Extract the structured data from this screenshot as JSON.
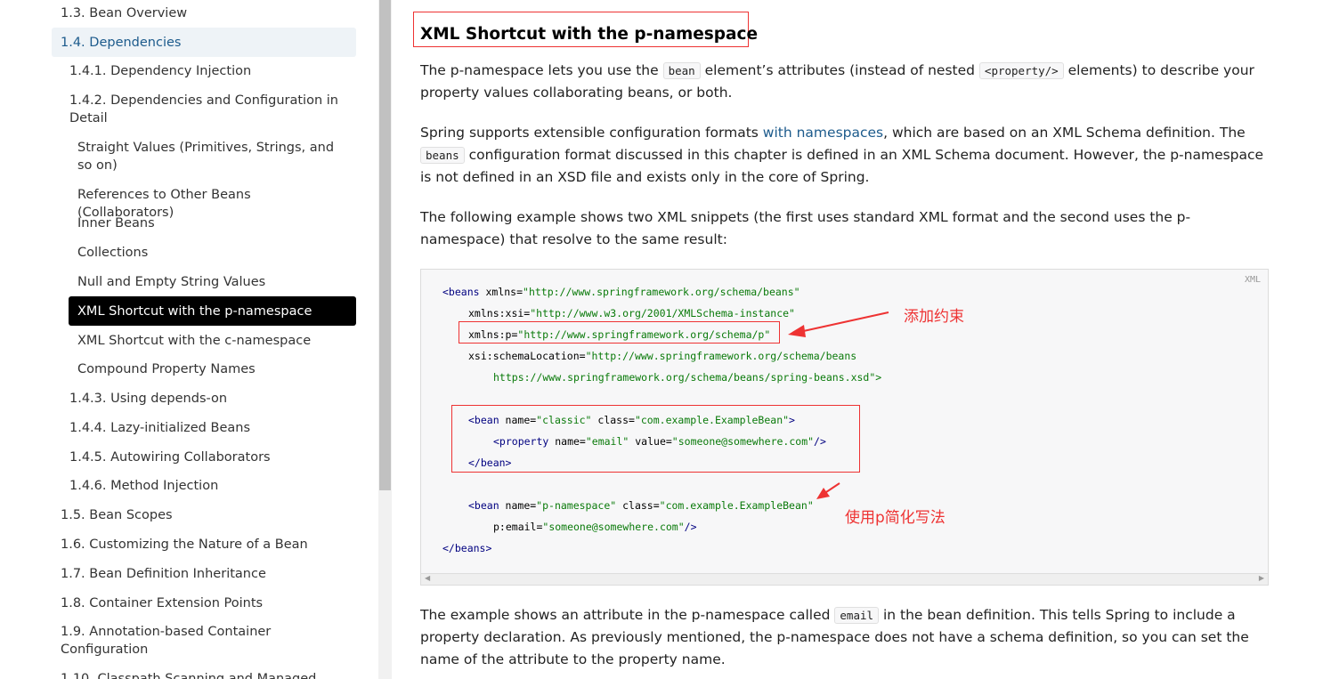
{
  "sidebar": {
    "items": [
      {
        "label": "1.3. Bean Overview"
      },
      {
        "label": "1.4. Dependencies"
      },
      {
        "label": "1.4.1. Dependency Injection"
      },
      {
        "label": "1.4.2. Dependencies and Configuration in Detail"
      },
      {
        "label": "Straight Values (Primitives, Strings, and so on)"
      },
      {
        "label": "References to Other Beans (Collaborators)"
      },
      {
        "label": "Inner Beans"
      },
      {
        "label": "Collections"
      },
      {
        "label": "Null and Empty String Values"
      },
      {
        "label": "XML Shortcut with the p-namespace"
      },
      {
        "label": "XML Shortcut with the c-namespace"
      },
      {
        "label": "Compound Property Names"
      },
      {
        "label": "1.4.3. Using depends-on"
      },
      {
        "label": "1.4.4. Lazy-initialized Beans"
      },
      {
        "label": "1.4.5. Autowiring Collaborators"
      },
      {
        "label": "1.4.6. Method Injection"
      },
      {
        "label": "1.5. Bean Scopes"
      },
      {
        "label": "1.6. Customizing the Nature of a Bean"
      },
      {
        "label": "1.7. Bean Definition Inheritance"
      },
      {
        "label": "1.8. Container Extension Points"
      },
      {
        "label": "1.9. Annotation-based Container Configuration"
      },
      {
        "label": "1.10. Classpath Scanning and Managed"
      }
    ]
  },
  "main": {
    "title": "XML Shortcut with the p-namespace",
    "p1": {
      "t1": "The p-namespace lets you use the ",
      "c1": "bean",
      "t2": " element’s attributes (instead of nested ",
      "c2": "<property/>",
      "t3": " elements) to describe your property values collaborating beans, or both."
    },
    "p2": {
      "t1": "Spring supports extensible configuration formats ",
      "link": "with namespaces",
      "t2": ", which are based on an XML Schema definition. The ",
      "c1": "beans",
      "t3": " configuration format discussed in this chapter is defined in an XML Schema document. However, the p-namespace is not defined in an XSD file and exists only in the core of Spring."
    },
    "p3": "The following example shows two XML snippets (the first uses standard XML format and the second uses the p-namespace) that resolve to the same result:",
    "code": {
      "lang": "XML",
      "lines": {
        "l1a": "<beans",
        "l1b": " xmlns=",
        "l1c": "\"http://www.springframework.org/schema/beans\"",
        "l2a": "xmlns:xsi=",
        "l2b": "\"http://www.w3.org/2001/XMLSchema-instance\"",
        "l3a": "xmlns:p=",
        "l3b": "\"http://www.springframework.org/schema/p\"",
        "l4a": "xsi:schemaLocation=",
        "l4b": "\"http://www.springframework.org/schema/beans",
        "l5": "https://www.springframework.org/schema/beans/spring-beans.xsd\">",
        "l6a": "<bean",
        "l6b": " name=",
        "l6c": "\"classic\"",
        "l6d": " class=",
        "l6e": "\"com.example.ExampleBean\"",
        "l6f": ">",
        "l7a": "<property",
        "l7b": " name=",
        "l7c": "\"email\"",
        "l7d": " value=",
        "l7e": "\"someone@somewhere.com\"",
        "l7f": "/>",
        "l8": "</bean>",
        "l9a": "<bean",
        "l9b": " name=",
        "l9c": "\"p-namespace\"",
        "l9d": " class=",
        "l9e": "\"com.example.ExampleBean\"",
        "l10a": "p:email=",
        "l10b": "\"someone@somewhere.com\"",
        "l10c": "/>",
        "l11": "</beans>"
      }
    },
    "annotations": {
      "a1": "添加约束",
      "a2": "使用p简化写法"
    },
    "p4": {
      "t1": "The example shows an attribute in the p-namespace called ",
      "c1": "email",
      "t2": " in the bean definition. This tells Spring to include a property declaration. As previously mentioned, the p-namespace does not have a schema definition, so you can set the name of the attribute to the property name."
    }
  },
  "colors": {
    "accent": "#1d5b8c",
    "annotation": "#e33333",
    "active_bg": "#000000"
  }
}
